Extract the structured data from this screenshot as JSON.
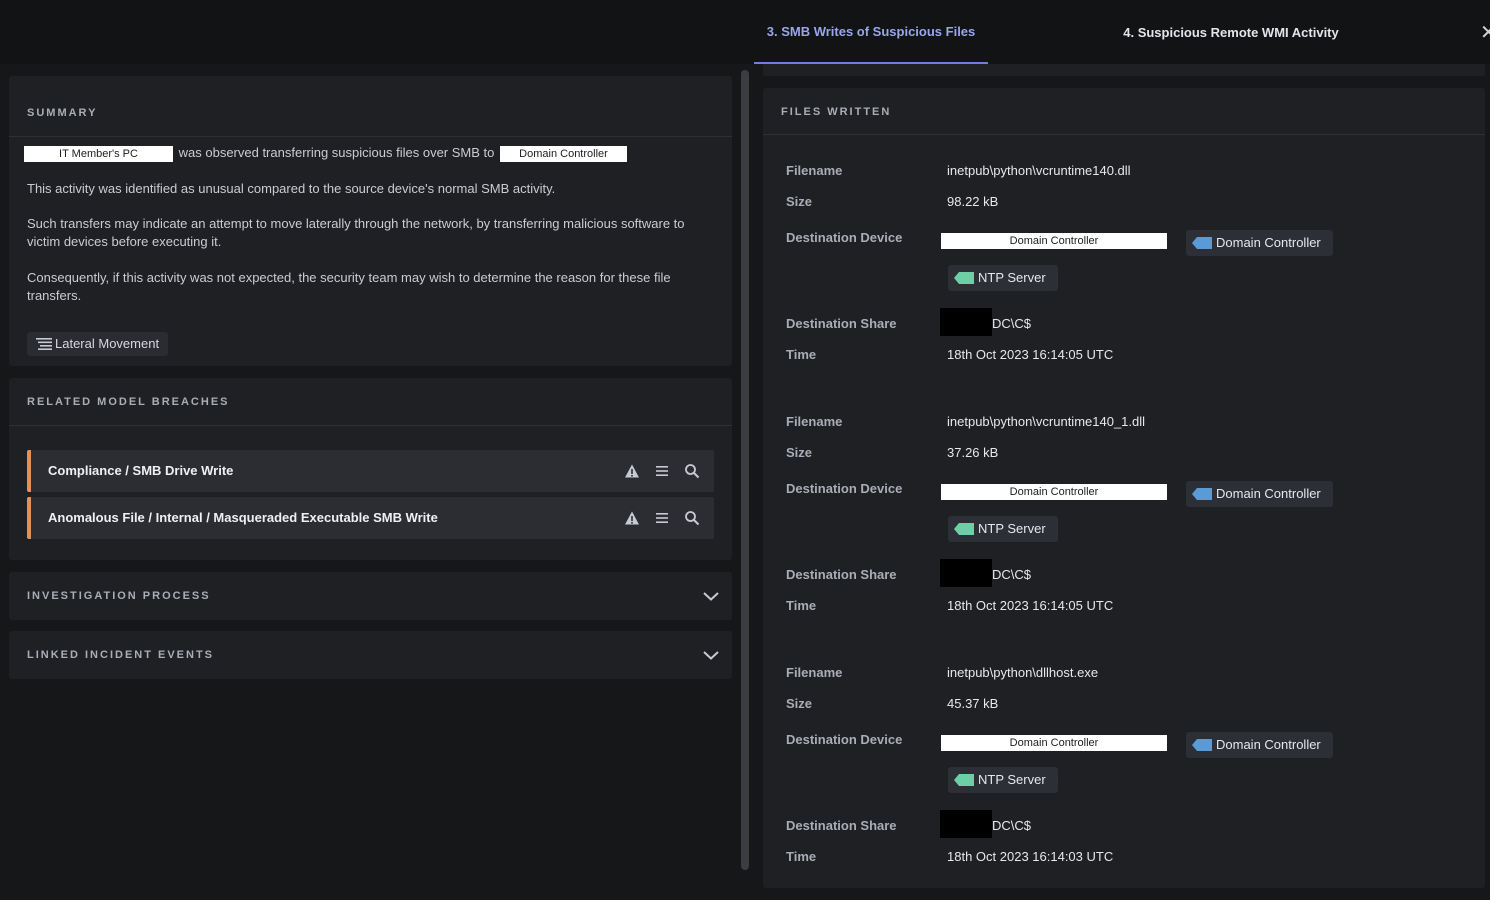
{
  "tabs": [
    {
      "label": "3. SMB Writes of Suspicious Files",
      "active": true
    },
    {
      "label": "4. Suspicious Remote WMI Activity",
      "active": false
    }
  ],
  "close_icon": "close-icon",
  "summary": {
    "title": "SUMMARY",
    "source_device": "IT Member's PC",
    "sentence_middle": "was observed transferring suspicious files over SMB to",
    "target_device": "Domain Controller",
    "paragraphs": [
      "This activity was identified as unusual compared to the source device's normal SMB activity.",
      "Such transfers may indicate an attempt to move laterally through the network, by transferring malicious software to victim devices before executing it.",
      "Consequently, if this activity was not expected, the security team may wish to determine the reason for these file transfers."
    ],
    "tag": "Lateral Movement"
  },
  "related": {
    "title": "RELATED MODEL BREACHES",
    "breaches": [
      {
        "label": "Compliance / SMB Drive Write"
      },
      {
        "label": "Anomalous File / Internal / Masqueraded Executable SMB Write"
      }
    ],
    "accent_color": "#e0925c"
  },
  "investigation": {
    "title": "INVESTIGATION PROCESS"
  },
  "linked": {
    "title": "LINKED INCIDENT EVENTS"
  },
  "files_written": {
    "title": "FILES WRITTEN",
    "labels": {
      "filename": "Filename",
      "size": "Size",
      "dest_device": "Destination Device",
      "dest_share": "Destination Share",
      "time": "Time"
    },
    "files": [
      {
        "filename": "inetpub\\python\\vcruntime140.dll",
        "size": "98.22 kB",
        "device_chip": "Domain Controller",
        "device_tag": "Domain Controller",
        "ntp_tag": "NTP Server",
        "share": "DC\\C$",
        "time": "18th Oct 2023 16:14:05 UTC"
      },
      {
        "filename": "inetpub\\python\\vcruntime140_1.dll",
        "size": "37.26 kB",
        "device_chip": "Domain Controller",
        "device_tag": "Domain Controller",
        "ntp_tag": "NTP Server",
        "share": "DC\\C$",
        "time": "18th Oct 2023 16:14:05 UTC"
      },
      {
        "filename": "inetpub\\python\\dllhost.exe",
        "size": "45.37 kB",
        "device_chip": "Domain Controller",
        "device_tag": "Domain Controller",
        "ntp_tag": "NTP Server",
        "share": "DC\\C$",
        "time": "18th Oct 2023 16:14:03 UTC"
      }
    ],
    "tag_colors": {
      "device": "#5a9ad6",
      "ntp": "#6dcfa5"
    }
  }
}
